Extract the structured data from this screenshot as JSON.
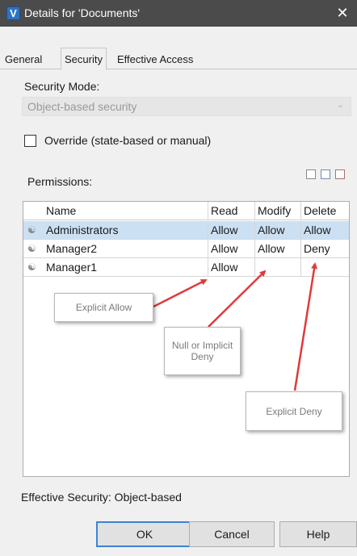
{
  "window": {
    "title": "Details for 'Documents'",
    "app_icon": "V",
    "close_glyph": "✕"
  },
  "tabs": [
    {
      "label": "General"
    },
    {
      "label": "Security"
    },
    {
      "label": "Effective Access"
    }
  ],
  "security": {
    "mode_label": "Security Mode:",
    "mode_value": "Object-based security",
    "override_label": "Override (state-based or manual)",
    "override_checked": false,
    "permissions_label": "Permissions:"
  },
  "grid": {
    "columns": [
      "Name",
      "Read",
      "Modify",
      "Delete"
    ],
    "rows": [
      {
        "name": "Administrators",
        "read": "Allow",
        "modify": "Allow",
        "delete": "Allow",
        "selected": true
      },
      {
        "name": "Manager2",
        "read": "Allow",
        "modify": "Allow",
        "delete": "Deny",
        "selected": false
      },
      {
        "name": "Manager1",
        "read": "Allow",
        "modify": "",
        "delete": "",
        "selected": false
      }
    ]
  },
  "callouts": {
    "explicit_allow": "Explicit Allow",
    "null_implicit_line1": "Null or Implicit",
    "null_implicit_line2": "Deny",
    "explicit_deny": "Explicit Deny"
  },
  "effective_security": "Effective Security: Object-based",
  "buttons": {
    "ok": "OK",
    "cancel": "Cancel",
    "help": "Help"
  },
  "colors": {
    "titlebar": "#4b4b4b",
    "selection": "#cce0f3",
    "arrow": "#e03a3a",
    "primary_border": "#3b83d6"
  },
  "icons": [
    "user-icon",
    "copy-icon",
    "edit-icon",
    "delete-icon",
    "dropdown-arrow-icon",
    "close-icon"
  ]
}
